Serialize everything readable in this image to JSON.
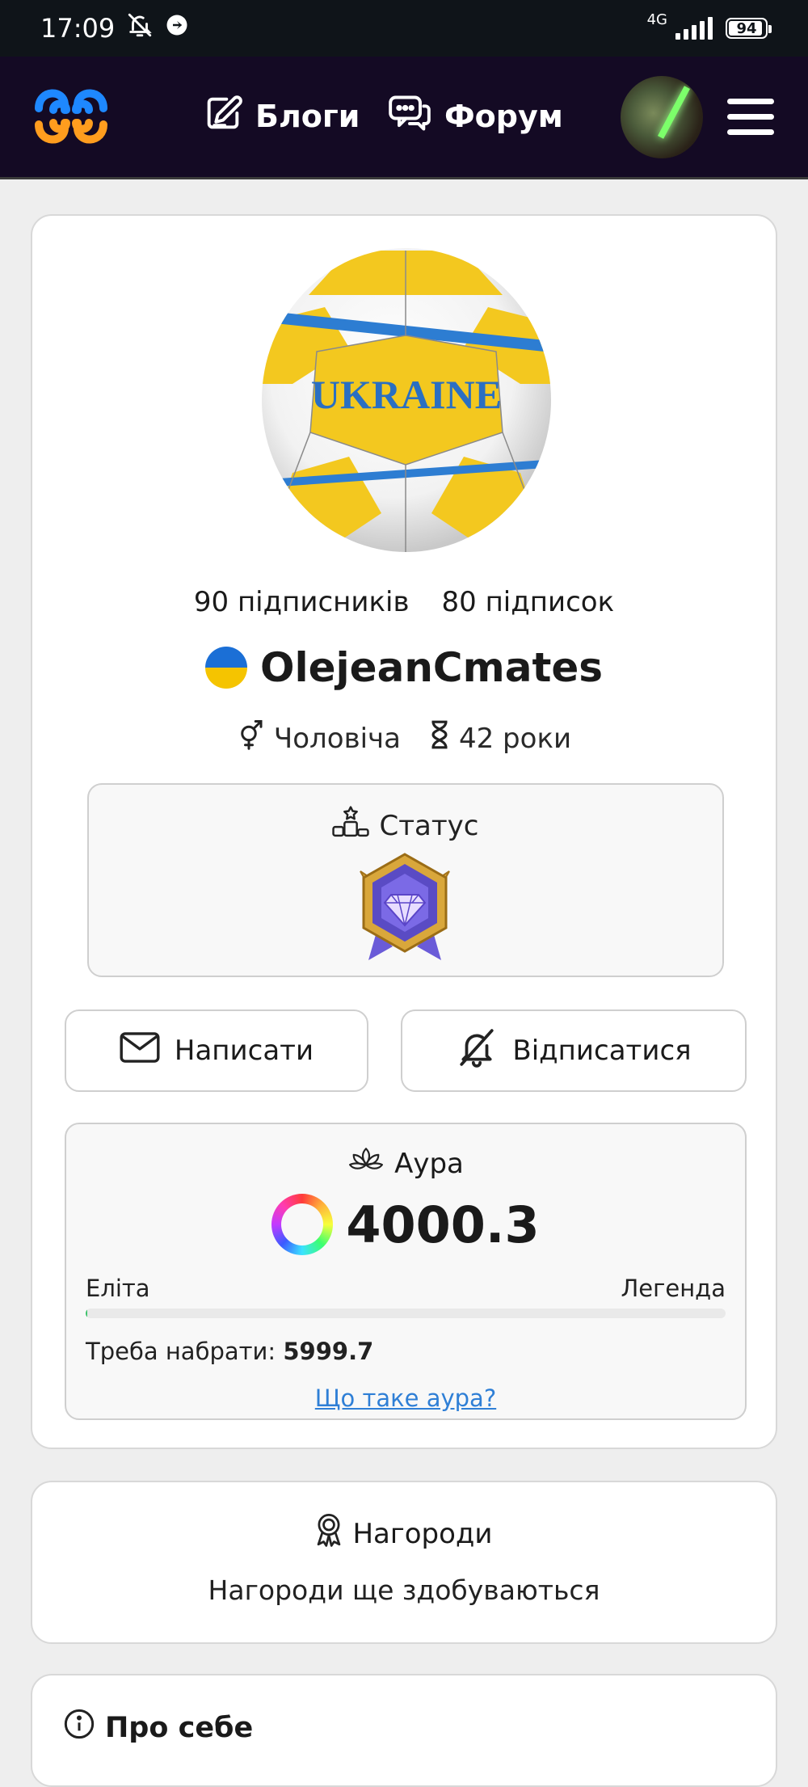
{
  "status_bar": {
    "time": "17:09",
    "network": "4G",
    "battery": "94",
    "icons": [
      "bell-off-icon",
      "direction-icon",
      "signal-icon",
      "battery-icon"
    ]
  },
  "header": {
    "logo": "site-logo",
    "nav": [
      {
        "label": "Блоги",
        "icon": "edit-icon"
      },
      {
        "label": "Форум",
        "icon": "chat-icon"
      }
    ],
    "menu_icon": "hamburger-icon"
  },
  "profile": {
    "followers": "90 підписників",
    "following": "80 підписок",
    "username": "OlejeanCmates",
    "gender": "Чоловіча",
    "age": "42 роки",
    "status_label": "Статус",
    "actions": {
      "write": "Написати",
      "unsubscribe": "Відписатися"
    },
    "avatar_text": "UKRAINE"
  },
  "aura": {
    "title": "Аура",
    "value": "4000.3",
    "level_current": "Еліта",
    "level_next": "Легенда",
    "progress_fraction": 0.001,
    "need_label": "Треба набрати:",
    "need_value": "5999.7",
    "link": "Що таке аура?"
  },
  "awards": {
    "title": "Нагороди",
    "text": "Нагороди ще здобуваються"
  },
  "about": {
    "title": "Про себе"
  },
  "colors": {
    "header_bg": "#140a24",
    "statusbar_bg": "#0f1419",
    "link": "#2f7fd6",
    "flag_blue": "#1b6fd6",
    "flag_yellow": "#f5c400"
  }
}
